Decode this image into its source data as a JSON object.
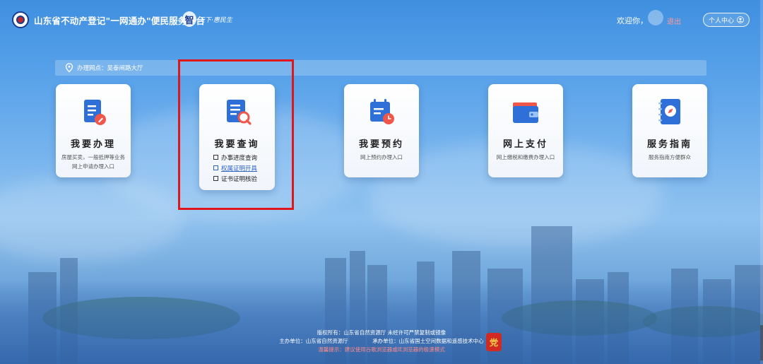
{
  "header": {
    "site_title": "山东省不动产登记\"一网通办\"便民服务平台",
    "slogan_mark": "智",
    "slogan_text": "天下·惠民生",
    "welcome": "欢迎你，",
    "logout": "退出",
    "user_center": "个人中心"
  },
  "location": {
    "text": "办理网点：吴泰闸路大厅"
  },
  "cards": [
    {
      "title": "我要办理",
      "desc": "房屋买卖，一般抵押等业务网上申请办理入口",
      "icon": "document-pen-icon"
    },
    {
      "title": "我要查询",
      "icon": "document-search-icon",
      "links": [
        "办事进度查询",
        "权属证明开具",
        "证书证明核验"
      ]
    },
    {
      "title": "我要预约",
      "desc": "网上预约办理入口",
      "icon": "calendar-clock-icon"
    },
    {
      "title": "网上支付",
      "desc": "网上缴税和缴费办理入口",
      "icon": "wallet-icon"
    },
    {
      "title": "服务指南",
      "desc": "服务指南方便群众",
      "icon": "compass-book-icon"
    }
  ],
  "colors": {
    "accent": "#2b64c6",
    "highlight": "#e0161d",
    "icon_blue": "#2e6fd8",
    "icon_red": "#f0564a"
  },
  "footer": {
    "copyright": "版权所有：山东省自然资源厅 未经许可严禁复制或镜像",
    "sponsor": "主办单位：山东省自然资源厅",
    "undertaker": "承办单位：山东省国土空间数据和遥感技术中心",
    "notice": "温馨提示：建议使用谷歌浏览器或IE浏览器的极速模式"
  }
}
